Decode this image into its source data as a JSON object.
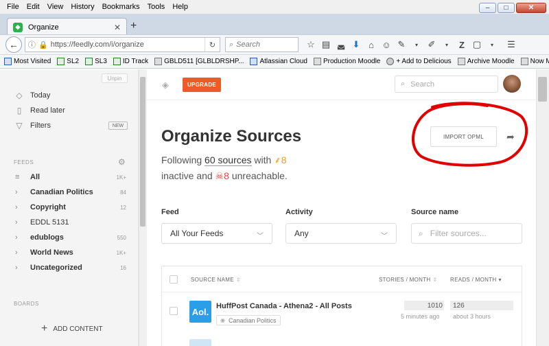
{
  "menubar": {
    "items": [
      "File",
      "Edit",
      "View",
      "History",
      "Bookmarks",
      "Tools",
      "Help"
    ]
  },
  "window": {
    "minimize": "–",
    "maximize": "□",
    "close": "✕"
  },
  "tab": {
    "title": "Organize",
    "close": "✕",
    "new_tab": "+"
  },
  "navbar": {
    "url": "https://feedly.com/i/organize",
    "search_placeholder": "Search"
  },
  "bookmarks": [
    "Most Visited",
    "SL2",
    "SL3",
    "ID Track",
    "GBLD511 [GLBLDRSHP...",
    "Atlassian Cloud",
    "Production Moodle",
    "+ Add to Delicious",
    "Archive Moodle",
    "Now Moodle"
  ],
  "sidebar": {
    "unpin": "Unpin",
    "nav": [
      {
        "label": "Today",
        "icon": "feedly-icon"
      },
      {
        "label": "Read later",
        "icon": "bookmark-icon"
      },
      {
        "label": "Filters",
        "icon": "filter-icon"
      }
    ],
    "new_badge": "NEW",
    "feeds_header": "FEEDS",
    "feeds": [
      {
        "name": "All",
        "count": "1K+"
      },
      {
        "name": "Canadian Politics",
        "count": "84"
      },
      {
        "name": "Copyright",
        "count": "12"
      },
      {
        "name": "EDDL 5131",
        "count": ""
      },
      {
        "name": "edublogs",
        "count": "550"
      },
      {
        "name": "World News",
        "count": "1K+"
      },
      {
        "name": "Uncategorized",
        "count": "16"
      }
    ],
    "boards_header": "BOARDS",
    "add_content": "ADD CONTENT"
  },
  "main": {
    "upgrade": "UPGRADE",
    "search_placeholder": "Search",
    "title": "Organize Sources",
    "following_prefix": "Following",
    "sources_link": "60 sources",
    "with": "with",
    "inactive_count": "8",
    "inactive_text": "inactive and",
    "unreachable_count": "8",
    "unreachable_text": "unreachable.",
    "import_opml": "IMPORT OPML",
    "filters": {
      "feed_label": "Feed",
      "feed_value": "All Your Feeds",
      "activity_label": "Activity",
      "activity_value": "Any",
      "source_label": "Source name",
      "source_placeholder": "Filter sources..."
    },
    "table": {
      "col_source": "SOURCE NAME",
      "col_stories": "STORIES / MONTH",
      "col_reads": "READS / MONTH",
      "rows": [
        {
          "logo": "Aol.",
          "title": "HuffPost Canada - Athena2 - All Posts",
          "tag": "Canadian Politics",
          "stories": "1010",
          "stories_sub": "5 minutes ago",
          "reads": "126",
          "reads_sub": "about 3 hours"
        }
      ]
    }
  },
  "colors": {
    "accent": "#ef5a29",
    "brand_green": "#2bb24c",
    "annotation": "#e00000"
  }
}
